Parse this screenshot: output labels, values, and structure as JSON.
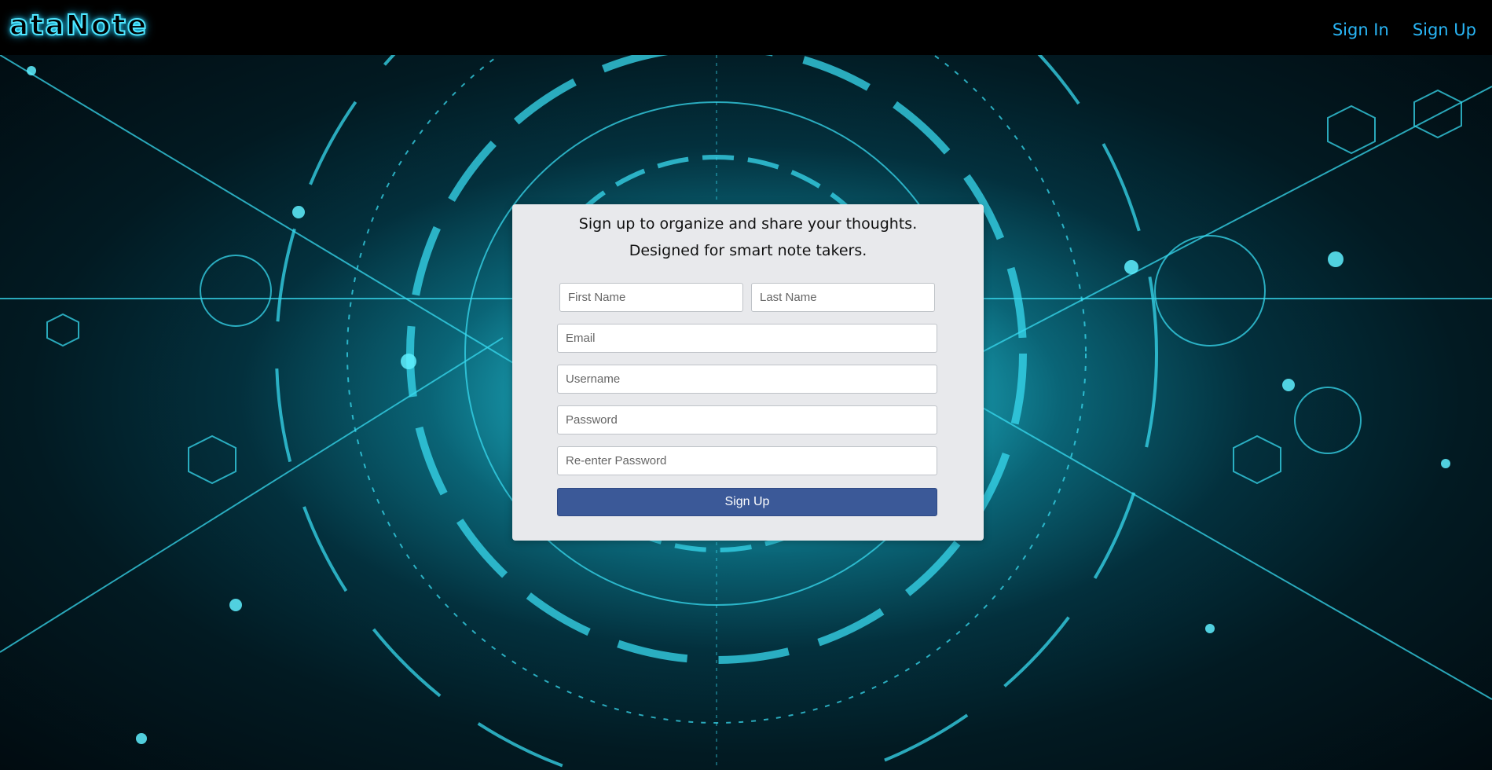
{
  "header": {
    "logo_text": "ataNote",
    "nav": {
      "sign_in": "Sign In",
      "sign_up": "Sign Up"
    }
  },
  "form": {
    "tagline_1": "Sign up to organize and share your thoughts.",
    "tagline_2": "Designed for smart note takers.",
    "first_name_placeholder": "First Name",
    "last_name_placeholder": "Last Name",
    "email_placeholder": "Email",
    "username_placeholder": "Username",
    "password_placeholder": "Password",
    "reenter_password_placeholder": "Re-enter Password",
    "submit_label": "Sign Up"
  },
  "colors": {
    "accent_cyan": "#29b6f6",
    "logo_glow": "#4fe6ff",
    "button_blue": "#3b5998",
    "card_bg": "#e8e9ec"
  }
}
